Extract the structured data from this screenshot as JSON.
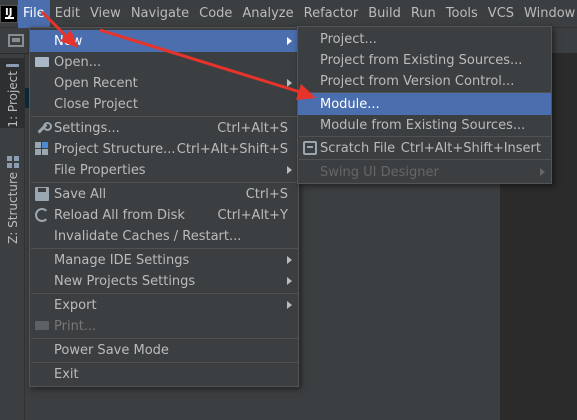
{
  "menubar": {
    "items": [
      "File",
      "Edit",
      "View",
      "Navigate",
      "Code",
      "Analyze",
      "Refactor",
      "Build",
      "Run",
      "Tools",
      "VCS",
      "Window"
    ],
    "active": "File"
  },
  "toolstrip": {
    "project_tab": "1: Project",
    "structure_tab": "Z: Structure"
  },
  "file_menu": {
    "new": "New",
    "open": "Open...",
    "open_recent": "Open Recent",
    "close_project": "Close Project",
    "settings": "Settings...",
    "settings_sc": "Ctrl+Alt+S",
    "project_structure": "Project Structure...",
    "project_structure_sc": "Ctrl+Alt+Shift+S",
    "file_properties": "File Properties",
    "save_all": "Save All",
    "save_all_sc": "Ctrl+S",
    "reload": "Reload All from Disk",
    "reload_sc": "Ctrl+Alt+Y",
    "invalidate": "Invalidate Caches / Restart...",
    "manage_ide": "Manage IDE Settings",
    "new_projects": "New Projects Settings",
    "export": "Export",
    "print": "Print...",
    "power_save": "Power Save Mode",
    "exit": "Exit"
  },
  "new_submenu": {
    "project": "Project...",
    "from_existing": "Project from Existing Sources...",
    "from_vcs": "Project from Version Control...",
    "module": "Module...",
    "module_existing": "Module from Existing Sources...",
    "scratch": "Scratch File",
    "scratch_sc": "Ctrl+Alt+Shift+Insert",
    "swing": "Swing UI Designer"
  },
  "colors": {
    "highlight": "#4b6eaf",
    "annotation_arrow": "#e8332b"
  }
}
